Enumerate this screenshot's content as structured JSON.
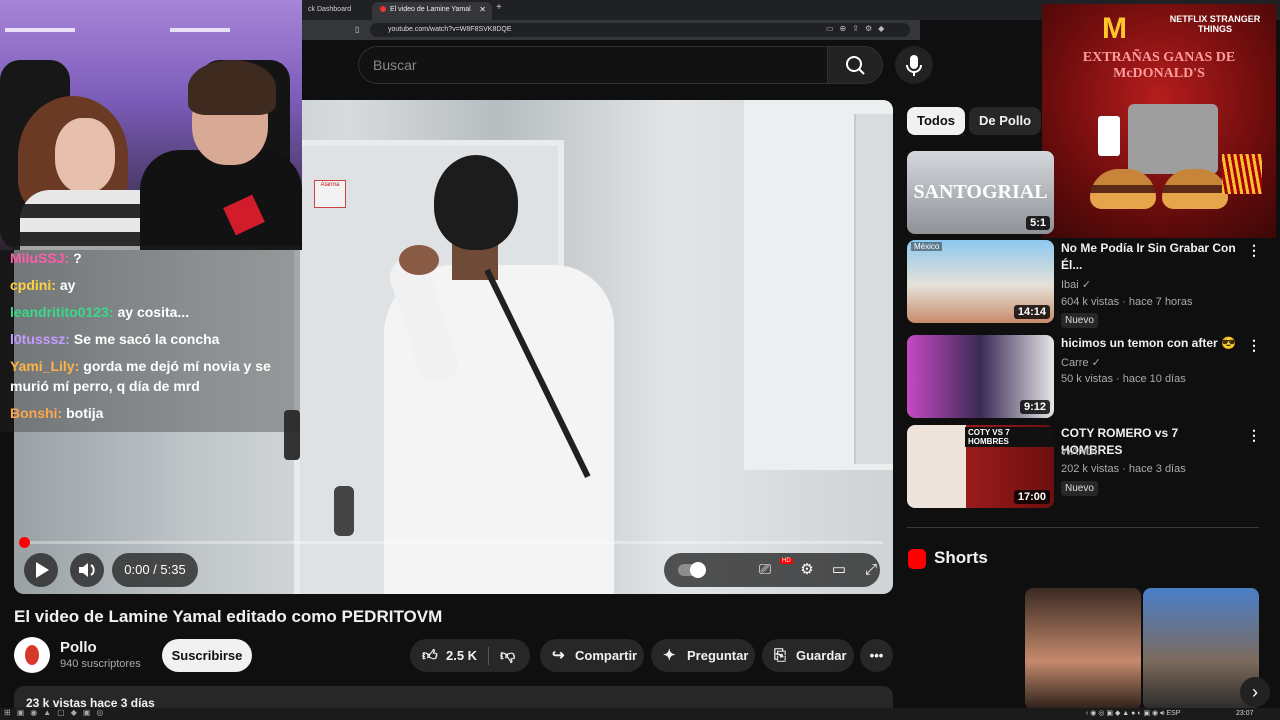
{
  "browser": {
    "tabs": [
      {
        "title": "ck Dashboard"
      },
      {
        "title": "El video de Lamine Yamal edita"
      }
    ],
    "url": "youtube.com/watch?v=W8F8SVK8DQE"
  },
  "search": {
    "placeholder": "Buscar"
  },
  "player": {
    "time": "0:00 / 5:35",
    "progress_fraction": 0.0,
    "alarm_sign": "Alarma"
  },
  "chat": {
    "messages": [
      {
        "user": "MiluSSJ:",
        "text": "?",
        "color": "#ff5ca8"
      },
      {
        "user": "cpdini:",
        "text": "ay",
        "color": "#ffd23f"
      },
      {
        "user": "leandritito0123:",
        "text": "ay cosita...",
        "color": "#39d98a"
      },
      {
        "user": "l0tusssz:",
        "text": "Se me sacó la concha",
        "color": "#c49bff"
      },
      {
        "user": "Yami_Lily:",
        "text": "gorda me dejó mí novia y se murió mí perro, q día de mrd",
        "color": "#ffb347"
      },
      {
        "user": "Bonshi:",
        "text": "botija",
        "color": "#ffa64d"
      }
    ]
  },
  "video": {
    "title": "El video de Lamine Yamal editado como PEDRITOVM",
    "channel": "Pollo",
    "subscribers": "940 suscriptores",
    "subscribe_label": "Suscribirse",
    "likes": "2.5 K",
    "share_label": "Compartir",
    "ask_label": "Preguntar",
    "save_label": "Guardar",
    "desc_line": "23 k vistas  hace 3 días"
  },
  "sidebar": {
    "chips": [
      "Todos",
      "De Pollo"
    ],
    "ad": {
      "brand": "NETFLIX STRANGER THINGS",
      "headline": "EXTRAÑAS GANAS DE McDONALD'S"
    },
    "videos": [
      {
        "title": "",
        "channel": "",
        "meta": "",
        "duration": "5:1",
        "thumb_text": "SANTOGRIAL"
      },
      {
        "title": "No Me Podía Ir Sin Grabar Con Él...",
        "channel": "Ibai",
        "meta": "604 k vistas · hace 7 horas",
        "duration": "14:14",
        "badge": "Nuevo",
        "thumb_text": "México"
      },
      {
        "title": "hicimos un temon con after 😎",
        "channel": "Carre",
        "meta": "50 k vistas · hace 10 días",
        "duration": "9:12"
      },
      {
        "title": "COTY ROMERO vs 7 HOMBRES",
        "channel": "WANDII",
        "meta": "202 k vistas · hace 3 días",
        "duration": "17:00",
        "badge": "Nuevo",
        "thumb_text": "COTY VS 7 HOMBRES"
      }
    ],
    "shorts_title": "Shorts"
  },
  "taskbar": {
    "lang": "ESP",
    "time": "23:07"
  }
}
